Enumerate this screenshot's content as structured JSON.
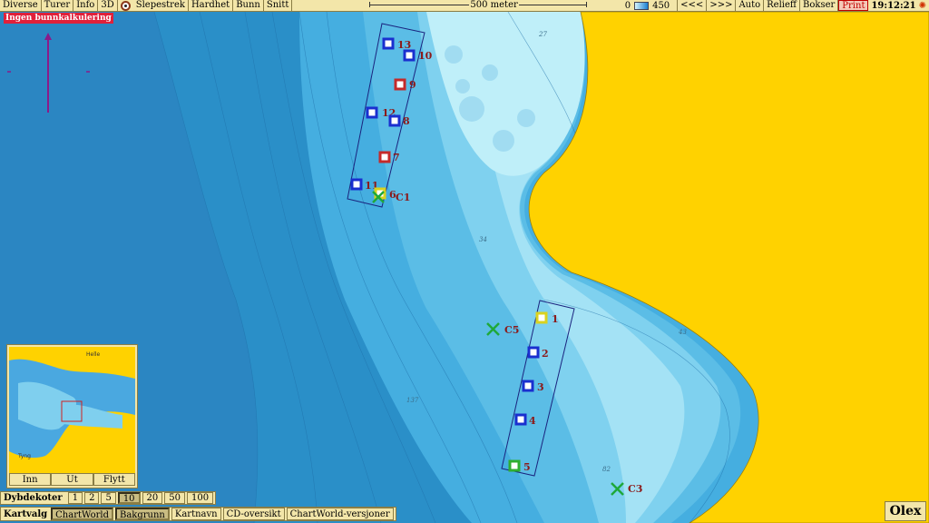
{
  "toolbar": {
    "items": [
      "Diverse",
      "Turer",
      "Info",
      "3D"
    ],
    "items2": [
      "Slepestrek",
      "Hardhet",
      "Bunn",
      "Snitt"
    ],
    "scale_label": "500 meter",
    "depth_min": "0",
    "depth_max": "450",
    "nav_prev": "<<<",
    "nav_next": ">>>",
    "auto": "Auto",
    "relieff": "Relieff",
    "bokser": "Bokser",
    "print": "Print",
    "time": "19:12:21"
  },
  "alert": "Ingen bunnkalkulering",
  "depth_labels": [
    "27",
    "34",
    "43",
    "137",
    "82"
  ],
  "stations": [
    {
      "label": "13",
      "color": "#1a2fcf"
    },
    {
      "label": "10",
      "color": "#1a2fcf"
    },
    {
      "label": "9",
      "color": "#c42a2a"
    },
    {
      "label": "12",
      "color": "#1a2fcf"
    },
    {
      "label": "8",
      "color": "#1a2fcf"
    },
    {
      "label": "7",
      "color": "#c42a2a"
    },
    {
      "label": "11",
      "color": "#1a2fcf"
    },
    {
      "label": "6",
      "color": "#d9d21f"
    },
    {
      "label": "1",
      "color": "#d9d21f"
    },
    {
      "label": "2",
      "color": "#1a2fcf"
    },
    {
      "label": "3",
      "color": "#1a2fcf"
    },
    {
      "label": "4",
      "color": "#1a2fcf"
    },
    {
      "label": "5",
      "color": "#2fae2f"
    }
  ],
  "crosses": [
    {
      "label": "C1"
    },
    {
      "label": "C5"
    },
    {
      "label": "C3"
    }
  ],
  "inset": {
    "buttons": [
      "Inn",
      "Ut",
      "Flytt"
    ],
    "labels": [
      "Helle",
      "Tyng"
    ]
  },
  "dybdekoter": {
    "label": "Dybdekoter",
    "options": [
      "1",
      "2",
      "5",
      "10",
      "20",
      "50",
      "100"
    ],
    "selected": "10"
  },
  "kartvalg": {
    "label": "Kartvalg",
    "options": [
      "ChartWorld",
      "Bakgrunn",
      "Kartnavn",
      "CD-oversikt",
      "ChartWorld-versjoner"
    ],
    "active": [
      "ChartWorld",
      "Bakgrunn"
    ]
  },
  "brand": "Olex",
  "colors": {
    "land": "#ffd200",
    "deep": "#2a8fc8",
    "mid": "#3fa9dd",
    "shallow": "#7dd3ef",
    "verylight": "#b6ecf7",
    "route": "#1a237e",
    "cross": "#1fa83a",
    "label": "#8b1a1a"
  }
}
